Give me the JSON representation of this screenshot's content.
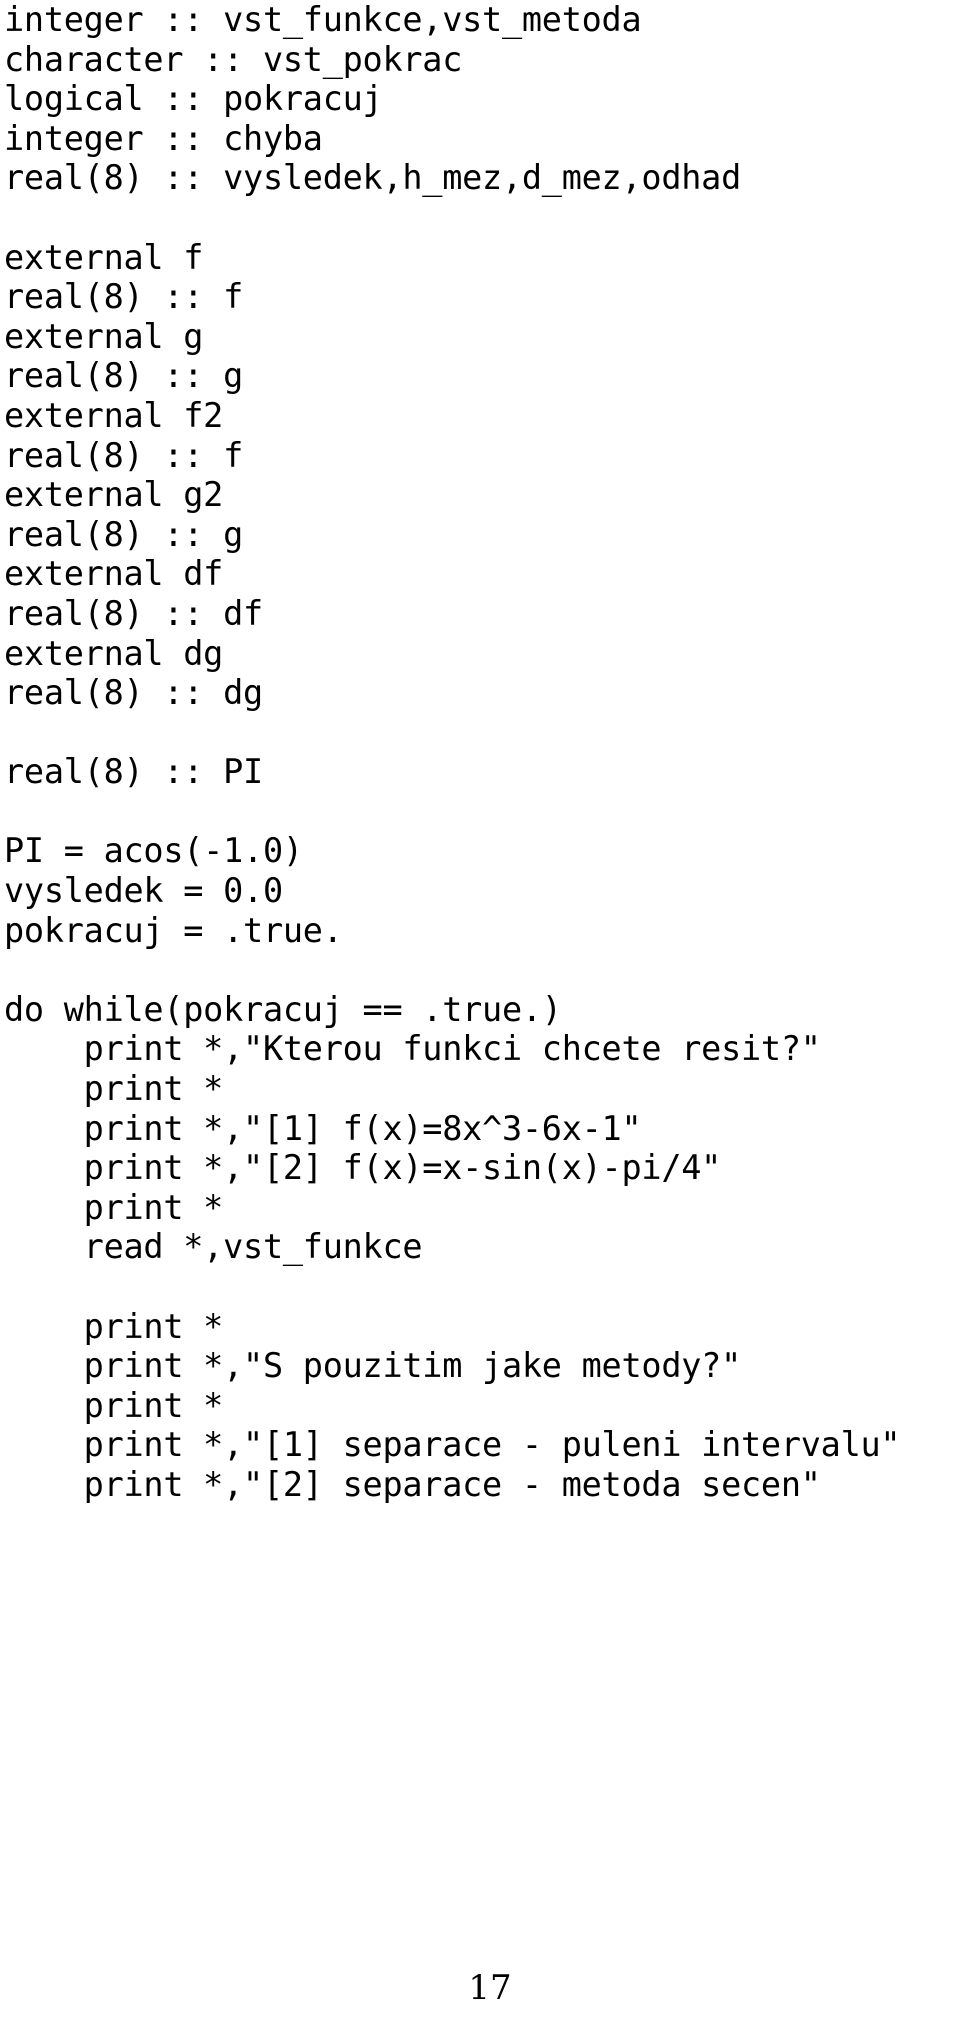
{
  "document": {
    "kind": "fortran-source-listing",
    "page_number": "17",
    "text_color": "#000000",
    "background_color": "#ffffff",
    "code_lines": [
      "integer :: vst_funkce,vst_metoda",
      "character :: vst_pokrac",
      "logical :: pokracuj",
      "integer :: chyba",
      "real(8) :: vysledek,h_mez,d_mez,odhad",
      "",
      "external f",
      "real(8) :: f",
      "external g",
      "real(8) :: g",
      "external f2",
      "real(8) :: f",
      "external g2",
      "real(8) :: g",
      "external df",
      "real(8) :: df",
      "external dg",
      "real(8) :: dg",
      "",
      "real(8) :: PI",
      "",
      "PI = acos(-1.0)",
      "vysledek = 0.0",
      "pokracuj = .true.",
      "",
      "do while(pokracuj == .true.)",
      "    print *,\"Kterou funkci chcete resit?\"",
      "    print *",
      "    print *,\"[1] f(x)=8x^3-6x-1\"",
      "    print *,\"[2] f(x)=x-sin(x)-pi/4\"",
      "    print *",
      "    read *,vst_funkce",
      "",
      "    print *",
      "    print *,\"S pouzitim jake metody?\"",
      "    print *",
      "    print *,\"[1] separace - puleni intervalu\"",
      "    print *,\"[2] separace - metoda secen\""
    ]
  }
}
